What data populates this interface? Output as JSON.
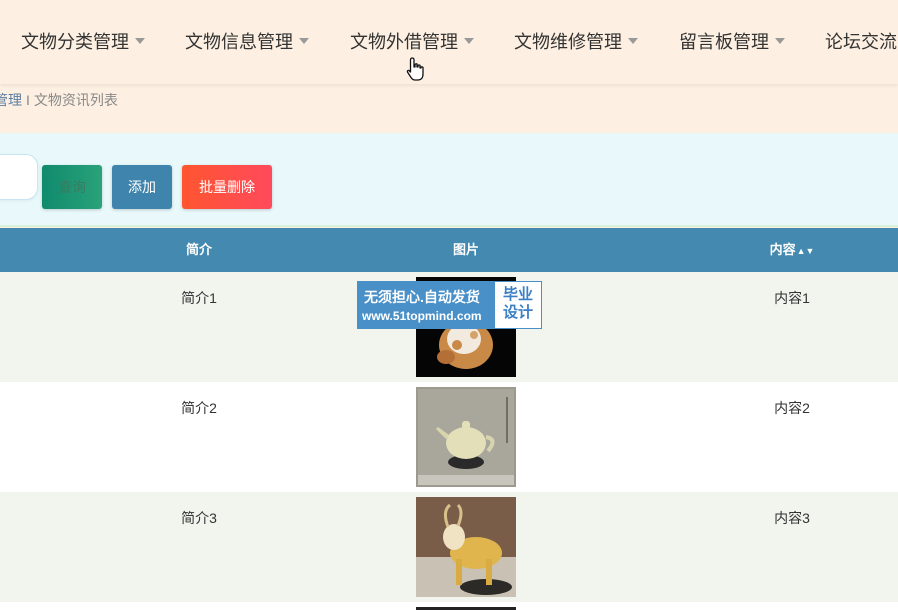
{
  "nav": {
    "items": [
      {
        "label": "文物分类管理",
        "has_caret": true
      },
      {
        "label": "文物信息管理",
        "has_caret": true
      },
      {
        "label": "文物外借管理",
        "has_caret": true
      },
      {
        "label": "文物维修管理",
        "has_caret": true
      },
      {
        "label": "留言板管理",
        "has_caret": true
      },
      {
        "label": "论坛交流",
        "has_caret": false
      }
    ]
  },
  "breadcrumb": {
    "first": "管理",
    "separator": "I",
    "current": "文物资讯列表"
  },
  "toolbar": {
    "query_label": "查询",
    "add_label": "添加",
    "bulk_delete_label": "批量删除"
  },
  "table": {
    "headers": {
      "intro": "简介",
      "image": "图片",
      "content": "内容"
    },
    "content_sort_icon": "sort-icon",
    "rows": [
      {
        "intro": "简介1",
        "image_icon": "artifact-jade-carving",
        "content": "内容1"
      },
      {
        "intro": "简介2",
        "image_icon": "artifact-jade-teapot",
        "content": "内容2"
      },
      {
        "intro": "简介3",
        "image_icon": "artifact-goat-statue",
        "content": "内容3"
      }
    ]
  },
  "watermark": {
    "line1": "无须担心.自动发货",
    "line2": "www.51topmind.com",
    "right_top": "毕业",
    "right_bottom": "设计"
  },
  "colors": {
    "nav_bg": "#fdf0e2",
    "search_bg": "#e8f8fb",
    "table_header_bg": "#4489b0",
    "add_button": "#3f84ad",
    "bulk_delete_button": "#ff5530",
    "query_button": "#0f8a6d"
  }
}
